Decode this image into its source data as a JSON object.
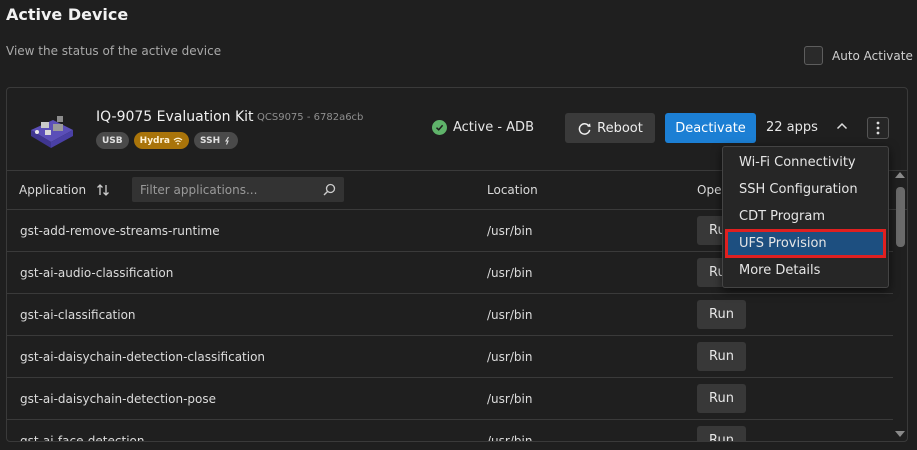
{
  "page": {
    "title": "Active Device",
    "subtitle": "View the status of the active device",
    "auto_activate_label": "Auto Activate"
  },
  "device": {
    "name": "IQ-9075 Evaluation Kit",
    "serial": "QCS9075 - 6782a6cb",
    "badges": {
      "usb": "USB",
      "hydra": "Hydra",
      "ssh": "SSH"
    },
    "status": "Active - ADB",
    "reboot_label": "Reboot",
    "deactivate_label": "Deactivate",
    "apps_count": "22 apps"
  },
  "table": {
    "col_application": "Application",
    "filter_placeholder": "Filter applications...",
    "col_location": "Location",
    "col_operations": "Ope",
    "rows": [
      {
        "name": "gst-add-remove-streams-runtime",
        "location": "/usr/bin",
        "action": "Run"
      },
      {
        "name": "gst-ai-audio-classification",
        "location": "/usr/bin",
        "action": "Run"
      },
      {
        "name": "gst-ai-classification",
        "location": "/usr/bin",
        "action": "Run"
      },
      {
        "name": "gst-ai-daisychain-detection-classification",
        "location": "/usr/bin",
        "action": "Run"
      },
      {
        "name": "gst-ai-daisychain-detection-pose",
        "location": "/usr/bin",
        "action": "Run"
      },
      {
        "name": "gst-ai-face-detection",
        "location": "/usr/bin",
        "action": "Run"
      }
    ]
  },
  "menu": {
    "items": [
      {
        "label": "Wi-Fi Connectivity"
      },
      {
        "label": "SSH Configuration"
      },
      {
        "label": "CDT Program"
      },
      {
        "label": "UFS Provision",
        "selected": true
      },
      {
        "label": "More Details"
      }
    ]
  },
  "colors": {
    "accent": "#1c7fd4",
    "status_ok": "#5fb36a",
    "hydra_badge": "#a9740a",
    "highlight_outline": "#e02020",
    "selected_item": "#1d4f80"
  },
  "icons": [
    "checkbox",
    "device-board-image",
    "wifi-icon",
    "link-icon",
    "check-circle-icon",
    "refresh-icon",
    "chevron-up-icon",
    "more-vertical-icon",
    "sort-icon",
    "search-icon"
  ]
}
